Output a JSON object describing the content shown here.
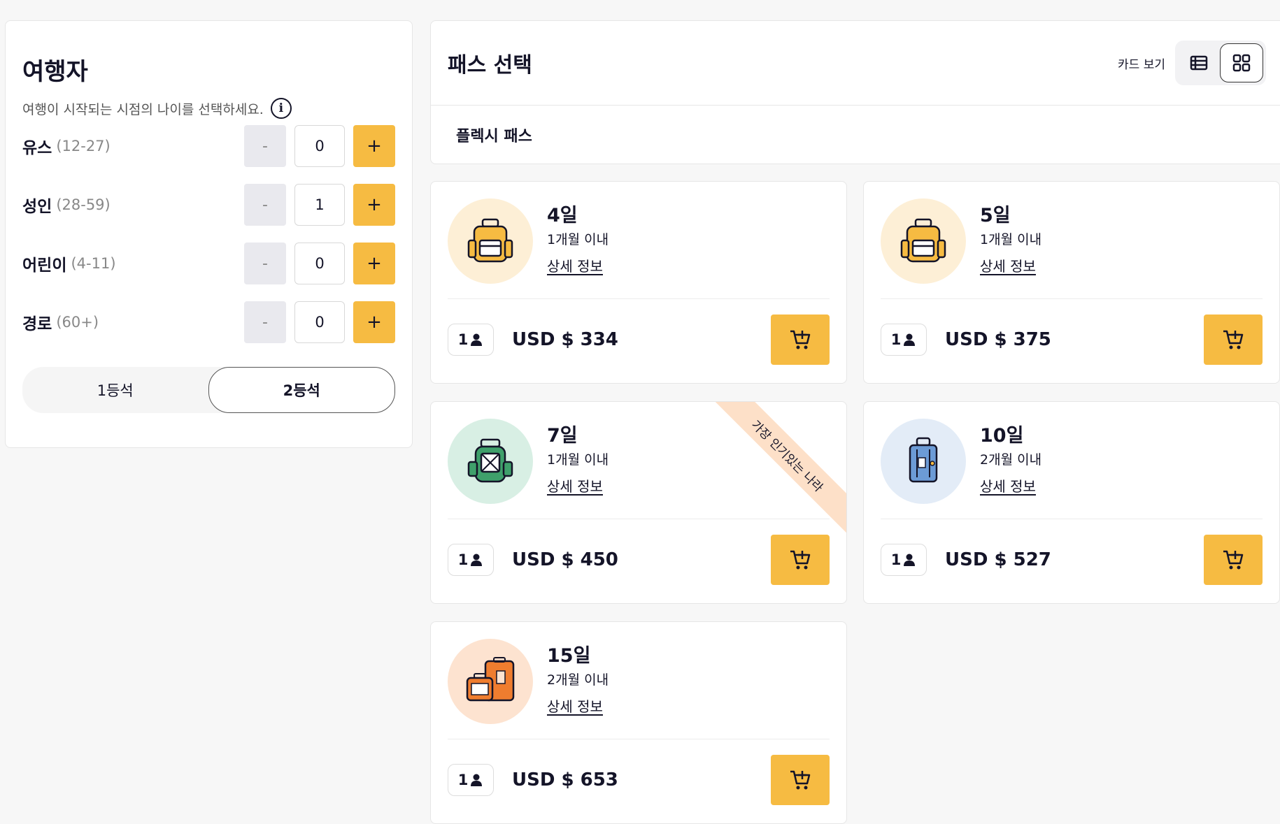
{
  "travelers": {
    "title": "여행자",
    "subtitle": "여행이 시작되는 시점의 나이를 선택하세요.",
    "info_icon": "info-icon",
    "minus_label": "-",
    "plus_label": "+",
    "rows": [
      {
        "label": "유스",
        "range": "(12-27)",
        "count": "0"
      },
      {
        "label": "성인",
        "range": "(28-59)",
        "count": "1"
      },
      {
        "label": "어린이",
        "range": "(4-11)",
        "count": "0"
      },
      {
        "label": "경로",
        "range": "(60+)",
        "count": "0"
      }
    ],
    "class_options": [
      "1등석",
      "2등석"
    ],
    "selected_class": "2등석"
  },
  "pass_select": {
    "title": "패스 선택",
    "view_label": "카드 보기",
    "tab": "플렉시 패스",
    "popular_ribbon": "가장 인기있는 나라",
    "cards": [
      {
        "days": "4일",
        "validity": "1개월 이내",
        "detail": "상세 정보",
        "pax": "1",
        "price": "USD $ 334",
        "icon": "backpack-icon",
        "color": "#fdefd6"
      },
      {
        "days": "5일",
        "validity": "1개월 이내",
        "detail": "상세 정보",
        "pax": "1",
        "price": "USD $ 375",
        "icon": "backpack-icon",
        "color": "#fdefd6"
      },
      {
        "days": "7일",
        "validity": "1개월 이내",
        "detail": "상세 정보",
        "pax": "1",
        "price": "USD $ 450",
        "icon": "green-backpack-icon",
        "color": "#d8efe4"
      },
      {
        "days": "10일",
        "validity": "2개월 이내",
        "detail": "상세 정보",
        "pax": "1",
        "price": "USD $ 527",
        "icon": "suitcase-icon",
        "color": "#e3ecf7"
      },
      {
        "days": "15일",
        "validity": "2개월 이내",
        "detail": "상세 정보",
        "pax": "1",
        "price": "USD $ 653",
        "icon": "luggage-icon",
        "color": "#fde3d0"
      }
    ]
  },
  "colors": {
    "accent": "#f6bb42",
    "text": "#141428"
  }
}
